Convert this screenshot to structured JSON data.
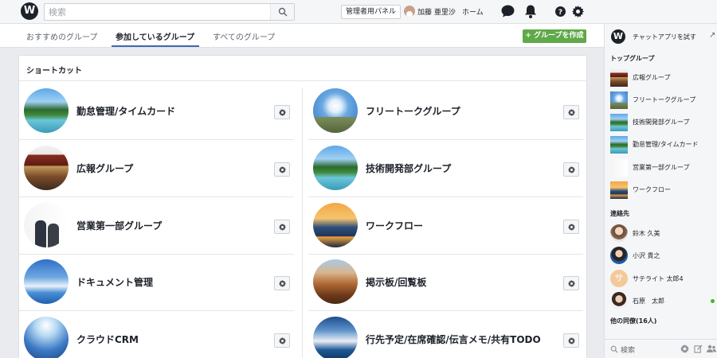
{
  "topbar": {
    "search_placeholder": "検索",
    "admin_panel": "管理者用パネル",
    "user_name": "加藤 亜里沙",
    "home": "ホーム"
  },
  "tabs": [
    {
      "label": "おすすめのグループ",
      "active": false
    },
    {
      "label": "参加しているグループ",
      "active": true
    },
    {
      "label": "すべてのグループ",
      "active": false
    }
  ],
  "create_group": "+ グループを作成",
  "shortcuts": {
    "title": "ショートカット",
    "left": [
      {
        "label": "勤怠管理/タイムカード",
        "thumb": "lake"
      },
      {
        "label": "広報グループ",
        "thumb": "temple"
      },
      {
        "label": "営業第一部グループ",
        "thumb": "people"
      },
      {
        "label": "ドキュメント管理",
        "thumb": "cloud"
      },
      {
        "label": "クラウドCRM",
        "thumb": "earth"
      }
    ],
    "right": [
      {
        "label": "フリートークグループ",
        "thumb": "sky"
      },
      {
        "label": "技術開発部グループ",
        "thumb": "lake"
      },
      {
        "label": "ワークフロー",
        "thumb": "fuji"
      },
      {
        "label": "掲示板/回覧板",
        "thumb": "canyon"
      },
      {
        "label": "行先予定/在席確認/伝言メモ/共有TODO",
        "thumb": "ocean"
      }
    ]
  },
  "sidebar": {
    "chat_try": "チャットアプリを試す",
    "top_groups_heading": "トップグループ",
    "top_groups": [
      {
        "label": "広報グループ",
        "thumb": "temple"
      },
      {
        "label": "フリートークグループ",
        "thumb": "sky"
      },
      {
        "label": "技術開発部グループ",
        "thumb": "lake"
      },
      {
        "label": "勤怠管理/タイムカード",
        "thumb": "lake"
      },
      {
        "label": "営業第一部グループ",
        "thumb": "people"
      },
      {
        "label": "ワークフロー",
        "thumb": "fuji"
      }
    ],
    "contacts_heading": "連絡先",
    "contacts": [
      {
        "name": "鈴木 久美",
        "avatar": "1",
        "initial": "",
        "online": false
      },
      {
        "name": "小沢 貴之",
        "avatar": "2",
        "initial": "",
        "online": false
      },
      {
        "name": "サテライト 太郎4",
        "avatar": "3",
        "initial": "サ",
        "online": false
      },
      {
        "name": "石原　太郎",
        "avatar": "4",
        "initial": "",
        "online": true
      }
    ],
    "colleagues_heading": "他の同僚(16人)",
    "search_label": "検索"
  },
  "colors": {
    "accent": "#4267b2",
    "create_button": "#5fa948",
    "online": "#42b72a"
  }
}
